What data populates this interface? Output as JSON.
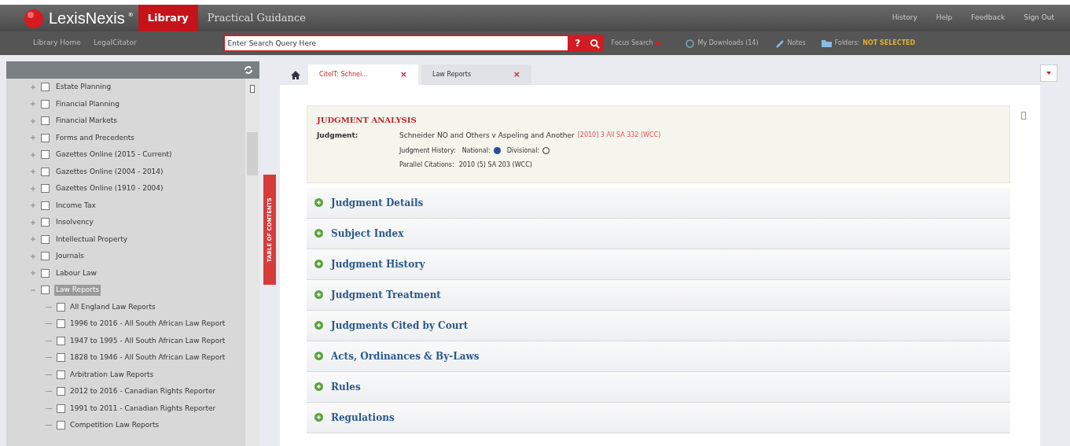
{
  "header": {
    "brand": "LexisNexis",
    "brand_mark": "®",
    "products": [
      {
        "label": "Library",
        "selected": true
      },
      {
        "label": "Practical Guidance",
        "selected": false
      }
    ],
    "links": [
      "History",
      "Help",
      "Feedback",
      "Sign Out"
    ]
  },
  "subnav": {
    "links": [
      "Library Home",
      "LegalCitator"
    ],
    "search": {
      "placeholder": "Enter Search Query Here",
      "help": "?"
    },
    "focus_search": "Focus Search",
    "downloads": "My Downloads (14)",
    "notes": "Notes",
    "folders_label": "Folders:",
    "folders_value": "NOT SELECTED"
  },
  "sidebar": {
    "toc_label": "TABLE OF CONTENTS",
    "items": [
      {
        "label": "Estate Planning",
        "checked": false,
        "selected": false,
        "expanded": false
      },
      {
        "label": "Financial Planning",
        "checked": false,
        "selected": false,
        "expanded": false
      },
      {
        "label": "Financial Markets",
        "checked": false,
        "selected": false,
        "expanded": false
      },
      {
        "label": "Forms and Precedents",
        "checked": false,
        "selected": false,
        "expanded": false
      },
      {
        "label": "Gazettes Online (2015 - Current)",
        "checked": false,
        "selected": false,
        "expanded": false
      },
      {
        "label": "Gazettes Online (2004 - 2014)",
        "checked": false,
        "selected": false,
        "expanded": false
      },
      {
        "label": "Gazettes Online (1910 - 2004)",
        "checked": false,
        "selected": false,
        "expanded": false
      },
      {
        "label": "Income Tax",
        "checked": false,
        "selected": false,
        "expanded": false
      },
      {
        "label": "Insolvency",
        "checked": false,
        "selected": false,
        "expanded": false
      },
      {
        "label": "Intellectual Property",
        "checked": false,
        "selected": false,
        "expanded": false
      },
      {
        "label": "Journals",
        "checked": false,
        "selected": false,
        "expanded": false
      },
      {
        "label": "Labour Law",
        "checked": false,
        "selected": false,
        "expanded": false
      },
      {
        "label": "Law Reports",
        "checked": false,
        "selected": true,
        "expanded": true,
        "children": [
          {
            "label": "All England Law Reports",
            "checked": false,
            "selected": false
          },
          {
            "label": "1996 to 2016 - All South African Law Report",
            "checked": false,
            "selected": false
          },
          {
            "label": "1947 to 1995 - All South African Law Report",
            "checked": false,
            "selected": false
          },
          {
            "label": "1828 to 1946 - All South African Law Report",
            "checked": false,
            "selected": false
          },
          {
            "label": "Arbitration Law Reports",
            "checked": false,
            "selected": false
          },
          {
            "label": "2012 to 2016 - Canadian Rights Reporter",
            "checked": false,
            "selected": false
          },
          {
            "label": "1991 to 2011 - Canadian Rights Reporter",
            "checked": false,
            "selected": false
          },
          {
            "label": "Competition Law Reports",
            "checked": false,
            "selected": false
          }
        ]
      }
    ]
  },
  "tabs": [
    {
      "label": "CiteIT: Schnei...",
      "close": "×",
      "selected": true
    },
    {
      "label": "Law Reports",
      "close": "×",
      "selected": false
    }
  ],
  "analysis": {
    "title": "JUDGMENT ANALYSIS",
    "judgment_label": "Judgment:",
    "case_name": "Schneider NO and Others v Aspeling and Another",
    "citation": "[2010] 3 All SA 332 (WCC)",
    "history_label": "Judgment History:",
    "history": [
      {
        "label": "National:",
        "filled": true
      },
      {
        "label": "Divisional:",
        "filled": false
      }
    ],
    "parallel_label": "Parallel Citations:",
    "parallel": "2010 (5) SA 203 (WCC)"
  },
  "sections": [
    {
      "label": "Judgment Details",
      "expanded": false
    },
    {
      "label": "Subject Index",
      "expanded": false
    },
    {
      "label": "Judgment History",
      "expanded": false
    },
    {
      "label": "Judgment Treatment",
      "expanded": false
    },
    {
      "label": "Judgments Cited by Court",
      "expanded": false
    },
    {
      "label": "Acts, Ordinances & By-Laws",
      "expanded": false
    },
    {
      "label": "Rules",
      "expanded": false
    },
    {
      "label": "Regulations",
      "expanded": false
    }
  ]
}
